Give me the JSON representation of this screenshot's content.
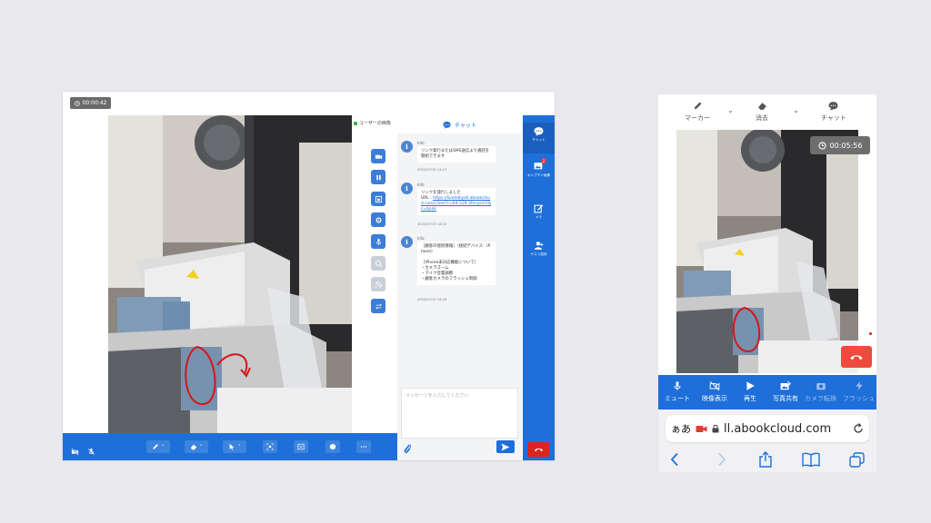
{
  "desktop": {
    "timer": "00:00:42",
    "user_video_label": "ユーザーの映像",
    "chat_title": "チャット",
    "messages": [
      {
        "sender": "Info",
        "text": "リンク発行またはSMS送信より通話を開始できます",
        "time": "2022/07/19 14:15"
      },
      {
        "sender": "Info",
        "text_prefix": "リンクを発行しました\nURL : ",
        "link": "https://livetalkyell.abookcloud.com/client?r=64-229-3fm-pmt1&c=bank",
        "time": "2022/07/19 14:15"
      },
      {
        "sender": "Info",
        "text": "［顧客の接続情報］（接続デバイス：iPhone）\n\n［iPhone未対応機能について］\n・カメラズーム\n・マイク音量調節\n・顧客カメラのフラッシュ制御",
        "time": "2022/07/19 14:16"
      }
    ],
    "chat_placeholder": "メッセージを入力してください",
    "side_nav": [
      {
        "label": "チャット",
        "icon": "chat-icon"
      },
      {
        "label": "キャプチャ画像",
        "icon": "capture-image-icon",
        "badge": "2"
      },
      {
        "label": "メモ",
        "icon": "memo-icon"
      },
      {
        "label": "ゲスト招待",
        "icon": "guest-invite-icon"
      }
    ]
  },
  "mobile": {
    "top_tools": [
      {
        "label": "マーカー",
        "icon": "marker-icon"
      },
      {
        "label": "消去",
        "icon": "eraser-icon"
      },
      {
        "label": "チャット",
        "icon": "chat-icon"
      }
    ],
    "timer": "00:05:56",
    "controls": [
      {
        "label": "ミュート",
        "icon": "mic-icon",
        "enabled": true
      },
      {
        "label": "映像表示",
        "icon": "video-off-icon",
        "enabled": true
      },
      {
        "label": "再生",
        "icon": "play-icon",
        "enabled": true
      },
      {
        "label": "写真共有",
        "icon": "photo-share-icon",
        "enabled": true
      },
      {
        "label": "カメラ転換",
        "icon": "camera-switch-icon",
        "enabled": false
      },
      {
        "label": "フラッシュ",
        "icon": "flash-icon",
        "enabled": false
      }
    ],
    "browser": {
      "aa": "ぁあ",
      "url": "ll.abookcloud.com"
    }
  },
  "colors": {
    "primary": "#1e6fd9",
    "danger": "#d9251c",
    "background": "#e9e8ed"
  }
}
